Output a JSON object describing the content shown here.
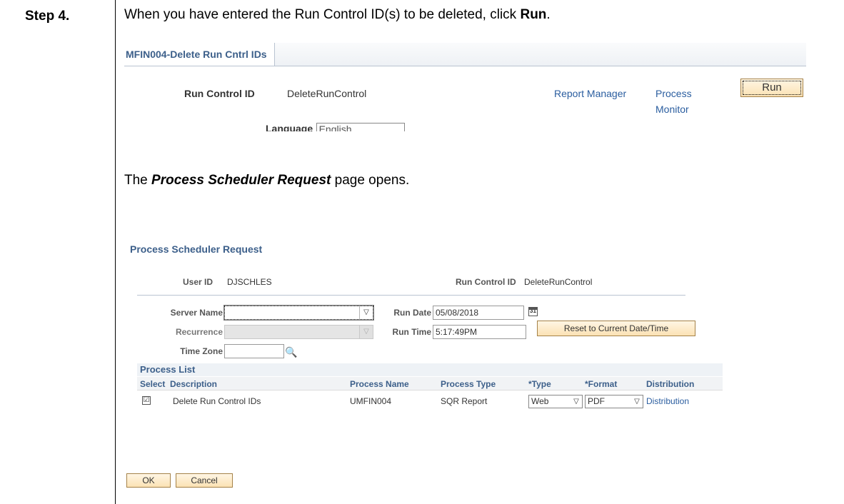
{
  "step": {
    "label": "Step 4.",
    "text_pre": "When you have entered the Run Control ID(s) to be deleted, click ",
    "text_bold": "Run",
    "text_post": "."
  },
  "top_page": {
    "tab_label": "MFIN004-Delete Run Cntrl IDs",
    "run_control_label": "Run Control ID",
    "run_control_value": "DeleteRunControl",
    "report_manager_link": "Report Manager",
    "process_monitor_link_line1": "Process",
    "process_monitor_link_line2": "Monitor",
    "run_button": "Run",
    "language_label": "Language",
    "language_value": "English"
  },
  "opens_text": {
    "pre": "The ",
    "bold": "Process Scheduler Request",
    "post": " page opens."
  },
  "psr": {
    "title": "Process Scheduler Request",
    "user_id_label": "User ID",
    "user_id_value": "DJSCHLES",
    "run_control_label": "Run Control ID",
    "run_control_value": "DeleteRunControl",
    "server_name_label": "Server Name",
    "server_name_value": "",
    "recurrence_label": "Recurrence",
    "recurrence_value": "",
    "time_zone_label": "Time Zone",
    "time_zone_value": "",
    "run_date_label": "Run Date",
    "run_date_value": "05/08/2018",
    "run_time_label": "Run Time",
    "run_time_value": "5:17:49PM",
    "reset_button": "Reset to Current Date/Time",
    "process_list_title": "Process List",
    "columns": [
      "Select",
      "Description",
      "Process Name",
      "Process Type",
      "*Type",
      "*Format",
      "Distribution"
    ],
    "rows": [
      {
        "selected": "☑",
        "description": "Delete Run Control IDs",
        "process_name": "UMFIN004",
        "process_type": "SQR Report",
        "type": "Web",
        "format": "PDF",
        "distribution": "Distribution"
      }
    ],
    "ok_button": "OK",
    "cancel_button": "Cancel"
  },
  "icons": {
    "dropdown": "▽",
    "calendar_day": "31",
    "lookup": "🔍"
  }
}
